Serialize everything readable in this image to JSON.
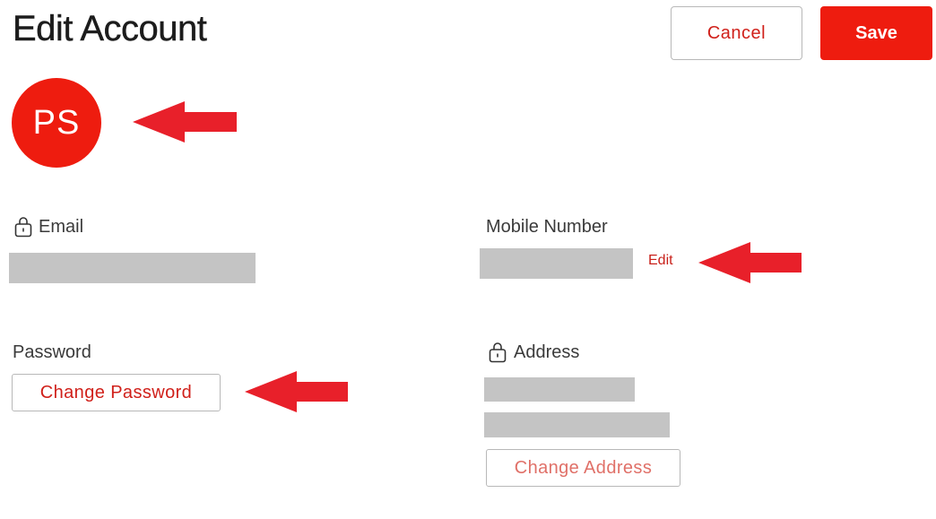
{
  "header": {
    "title": "Edit Account",
    "cancel_label": "Cancel",
    "save_label": "Save"
  },
  "avatar": {
    "initials": "PS"
  },
  "fields": {
    "email_label": "Email",
    "mobile_label": "Mobile Number",
    "mobile_edit_label": "Edit",
    "password_label": "Password",
    "change_password_label": "Change Password",
    "address_label": "Address",
    "change_address_label": "Change Address"
  },
  "colors": {
    "accent": "#ee1c0f",
    "accent_text": "#d0201a",
    "annotation_arrow": "#e8202a",
    "redacted": "#c4c4c4"
  },
  "icons": {
    "field_lock": "lock-icon",
    "annotation": "arrow-left-icon"
  }
}
